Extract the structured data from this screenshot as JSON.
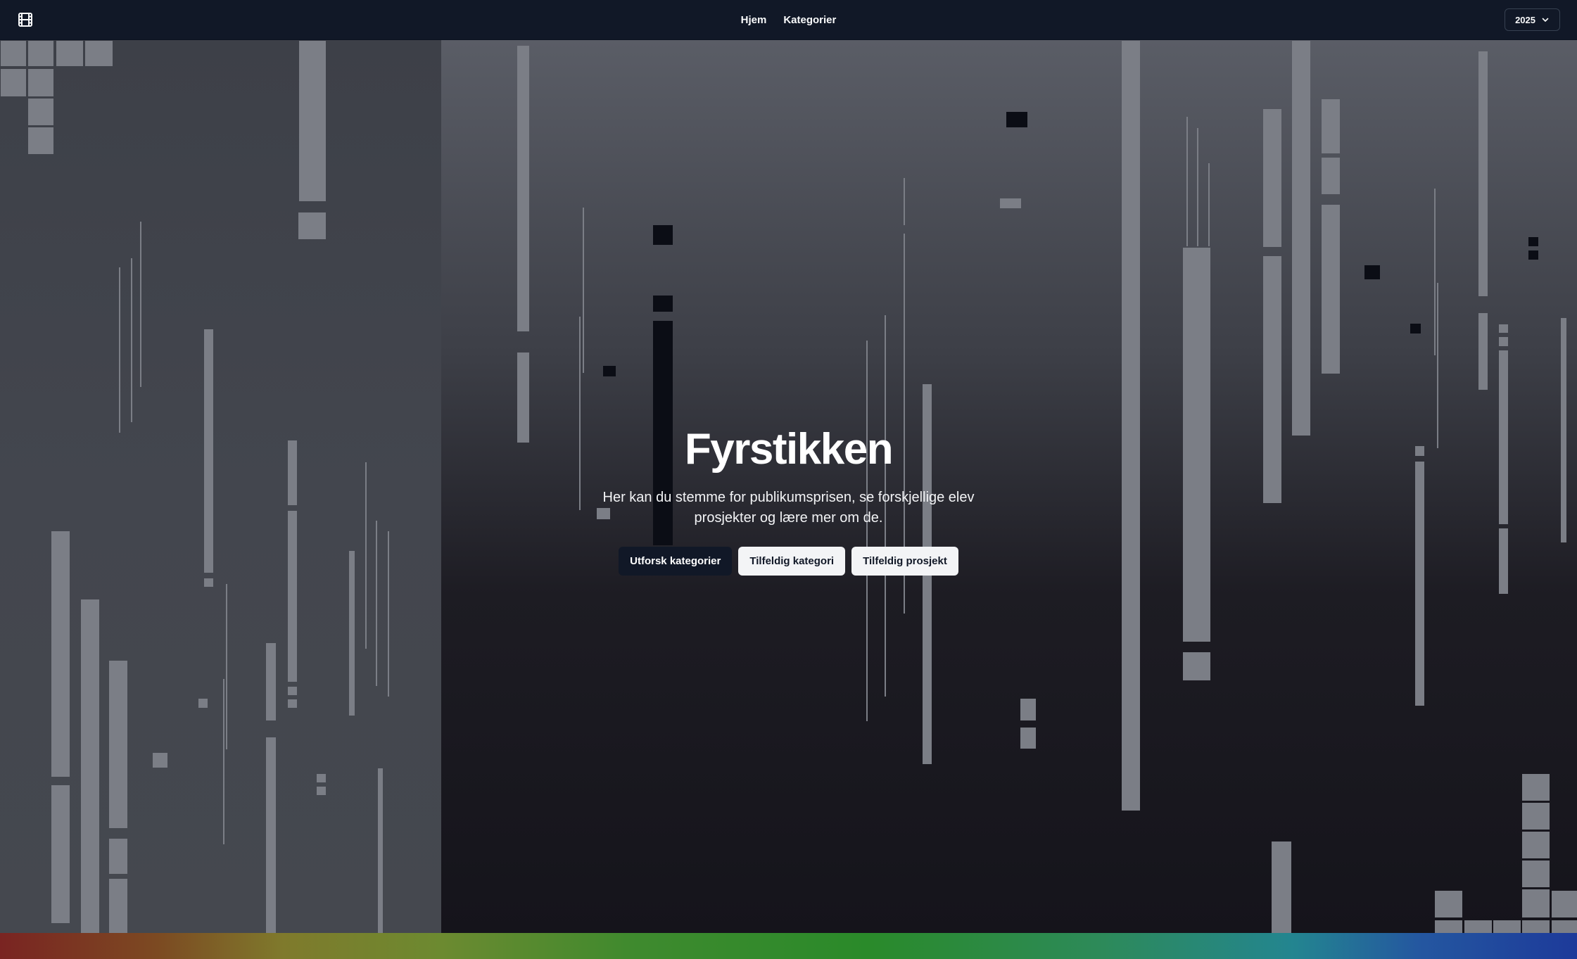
{
  "nav": {
    "logo_icon": "film-icon",
    "links": [
      {
        "label": "Hjem"
      },
      {
        "label": "Kategorier"
      }
    ],
    "year_select": {
      "value": "2025",
      "icon": "chevron-down-icon"
    }
  },
  "hero": {
    "title": "Fyrstikken",
    "subtitle": "Her kan du stemme for publikumsprisen, se forskjellige elev prosjekter og lære mer om de.",
    "buttons": {
      "primary": "Utforsk kategorier",
      "random_category": "Tilfeldig kategori",
      "random_project": "Tilfeldig prosjekt"
    }
  },
  "colors": {
    "navbar": "#111827",
    "primary_button": "#111827",
    "secondary_button": "#f3f4f6",
    "bar_light": "#7b7e86",
    "bar_dark": "#0b0d15"
  }
}
